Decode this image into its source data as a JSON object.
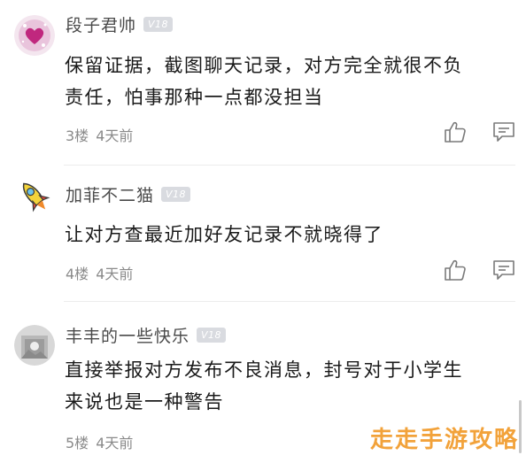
{
  "comments": [
    {
      "username": "段子君帅",
      "badge": "V18",
      "content_lines": [
        "保留证据，截图聊天记录，对方完全就很不负",
        "责任，怕事那种一点都没担当"
      ],
      "floor": "3楼",
      "time": "4天前",
      "avatar_icon": "pink-sparkle-heart-avatar",
      "show_actions": true
    },
    {
      "username": "加菲不二猫",
      "badge": "V18",
      "content_lines": [
        "让对方查最近加好友记录不就晓得了"
      ],
      "floor": "4楼",
      "time": "4天前",
      "avatar_icon": "rocket-avatar",
      "show_actions": true
    },
    {
      "username": "丰丰的一些快乐",
      "badge": "V18",
      "content_lines": [
        "直接举报对方发布不良消息，封号对于小学生",
        "来说也是一种警告"
      ],
      "floor": "5楼",
      "time": "4天前",
      "avatar_icon": "photo-avatar",
      "show_actions": false
    }
  ],
  "icons": {
    "like": "thumbs-up-icon",
    "reply": "comment-icon"
  },
  "watermark": "走走手游攻略",
  "colors": {
    "username": "#4a4a4a",
    "meta": "#8a8a8a",
    "badge_bg": "#d9dbe0",
    "watermark": "#f2a23a"
  }
}
